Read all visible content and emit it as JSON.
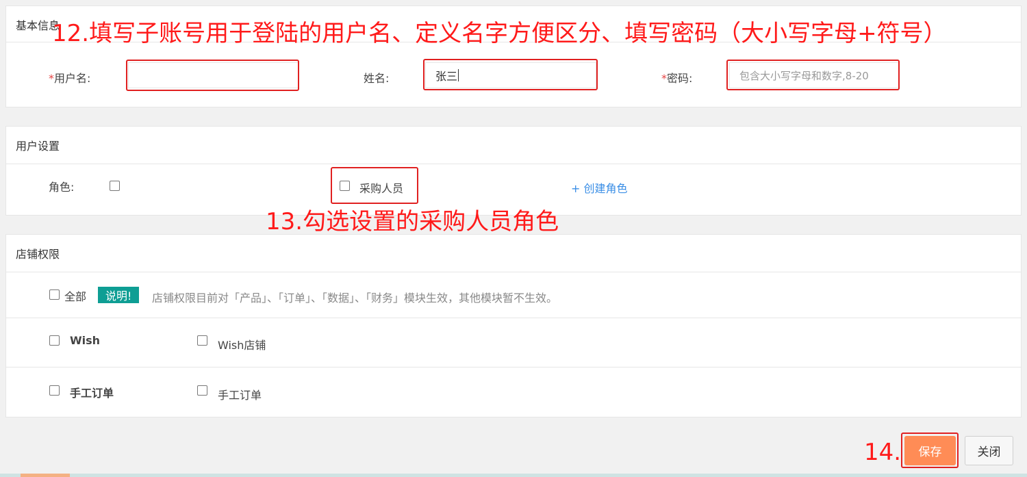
{
  "basic_info": {
    "title": "基本信息",
    "username": {
      "required_mark": "*",
      "label": "用户名:",
      "value": ""
    },
    "name": {
      "label": "姓名:",
      "value": "张三"
    },
    "password": {
      "required_mark": "*",
      "label": "密码:",
      "placeholder": "包含大小写字母和数字,8-20"
    }
  },
  "user_settings": {
    "title": "用户设置",
    "role_label": "角色:",
    "role_option": "采购人员",
    "create_role_link": "+ 创建角色"
  },
  "shop_permissions": {
    "title": "店铺权限",
    "all_label": "全部",
    "badge": "说明!",
    "note": "店铺权限目前对「产品」、「订单」、「数据」、「财务」模块生效，其他模块暂不生效。",
    "rows": [
      {
        "group": "Wish",
        "shop": "Wish店铺"
      },
      {
        "group": "手工订单",
        "shop": "手工订单"
      }
    ]
  },
  "footer": {
    "save_label": "保存",
    "close_label": "关闭"
  },
  "annotations": {
    "step12": "12.填写子账号用于登陆的用户名、定义名字方便区分、填写密码（大小写字母+符号）",
    "step13": "13.勾选设置的采购人员角色",
    "step14": "14."
  },
  "colors": {
    "annotation_red": "#ff1a1a",
    "save_button": "#ff8c56",
    "badge_teal": "#0e9e94",
    "link_blue": "#3a8ee6"
  }
}
